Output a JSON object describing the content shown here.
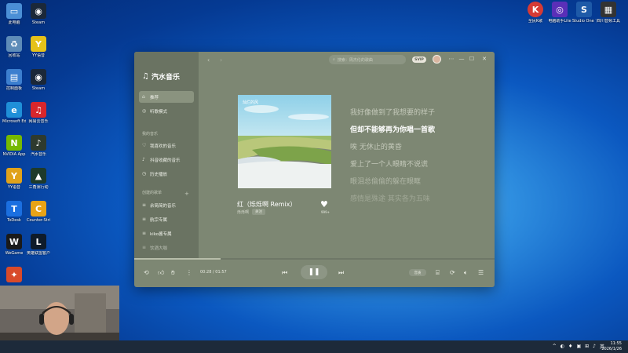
{
  "desktop": {
    "left_icons": [
      {
        "label": "此电脑",
        "color": "#4b8fd6",
        "glyph": "▭"
      },
      {
        "label": "Steam",
        "color": "#1b2838",
        "glyph": "◉"
      },
      {
        "label": "回收站",
        "color": "#5e8cb8",
        "glyph": "♻"
      },
      {
        "label": "YY语音",
        "color": "#e6c21a",
        "glyph": "Y"
      },
      {
        "label": "控制面板",
        "color": "#3c7fcf",
        "glyph": "▤"
      },
      {
        "label": "Steam",
        "color": "#1b2838",
        "glyph": "◉"
      },
      {
        "label": "Microsoft Edge",
        "color": "#1f8fd8",
        "glyph": "e"
      },
      {
        "label": "网易云音乐",
        "color": "#d8262c",
        "glyph": "♫"
      },
      {
        "label": "NVIDIA App",
        "color": "#76b900",
        "glyph": "N"
      },
      {
        "label": "汽水音乐",
        "color": "#2e3a2e",
        "glyph": "♪"
      },
      {
        "label": "YY语音",
        "color": "#e0a21a",
        "glyph": "Y"
      },
      {
        "label": "三角洲行动",
        "color": "#1e3a2a",
        "glyph": "▲"
      },
      {
        "label": "ToDesk",
        "color": "#1b6fe0",
        "glyph": "T"
      },
      {
        "label": "Counter-Strike 2",
        "color": "#e8a316",
        "glyph": "C"
      },
      {
        "label": "WeGame",
        "color": "#1a1a1a",
        "glyph": "W"
      },
      {
        "label": "英雄联盟客户端",
        "color": "#0e1b2a",
        "glyph": "L"
      },
      {
        "label": "",
        "color": "#d84a2a",
        "glyph": "✦"
      }
    ],
    "right_icons": [
      {
        "label": "全民K歌",
        "color": "#d63a35",
        "glyph": "K"
      },
      {
        "label": "电脑助手Lite",
        "color": "#5a2fb8",
        "glyph": "◎"
      },
      {
        "label": "Studio One 7",
        "color": "#1e5aa8",
        "glyph": "S"
      },
      {
        "label": "四川音频工具箱",
        "color": "#333333",
        "glyph": "▦"
      }
    ]
  },
  "music_app": {
    "app_name": "汽水音乐",
    "nav": [
      {
        "label": "推荐",
        "icon": "home-icon",
        "glyph": "⌂",
        "active": true
      },
      {
        "label": "听歌模式",
        "icon": "compass-icon",
        "glyph": "◎",
        "active": false
      }
    ],
    "my_music_title": "我的音乐",
    "my_music": [
      {
        "label": "我喜欢的音乐",
        "icon": "heart-icon",
        "glyph": "♡"
      },
      {
        "label": "抖音收藏的音乐",
        "icon": "douyin-icon",
        "glyph": "♪"
      },
      {
        "label": "历史播放",
        "icon": "clock-icon",
        "glyph": "◷"
      }
    ],
    "playlists_title": "创建的歌单",
    "playlists": [
      {
        "label": "余简简的音乐",
        "glyph": "≡"
      },
      {
        "label": "航宗专属",
        "glyph": "≡"
      },
      {
        "label": "kiko酱专属",
        "glyph": "≡"
      },
      {
        "label": "饮酒大咖",
        "glyph": "≡"
      }
    ],
    "search_placeholder": "搜索：周杰伦的歌曲",
    "svip": "SVIP",
    "window_controls": {
      "menu": "⋯",
      "minimize": "—",
      "maximize": "☐",
      "close": "✕"
    },
    "song": {
      "title": "红（烁烁啊 Remix）",
      "artist": "烁烁啊",
      "follow": "关注",
      "like_count": "999+",
      "cover_caption": "灿烂的风"
    },
    "lyrics": [
      {
        "text": "我好像做到了我想要的样子",
        "current": false
      },
      {
        "text": "但却不能够再为你唱一首歌",
        "current": true
      },
      {
        "text": "唉 无休止的黄昏",
        "current": false
      },
      {
        "text": "爱上了一个人眼睛不说谎",
        "current": false
      },
      {
        "text": "眼泪总偷偷的躲在眼眶",
        "current": false
      },
      {
        "text": "感情是殊途 其实各为五味",
        "current": false
      }
    ],
    "player": {
      "current_time": "00:28",
      "total_time": "01:57",
      "progress": 0.24,
      "quality": "音质"
    }
  },
  "taskbar": {
    "time": "11:55",
    "date": "2026/1/26",
    "ime": "英",
    "tray_icons": [
      "^",
      "◐",
      "♦",
      "▣",
      "⊞",
      "♪",
      "英"
    ]
  }
}
